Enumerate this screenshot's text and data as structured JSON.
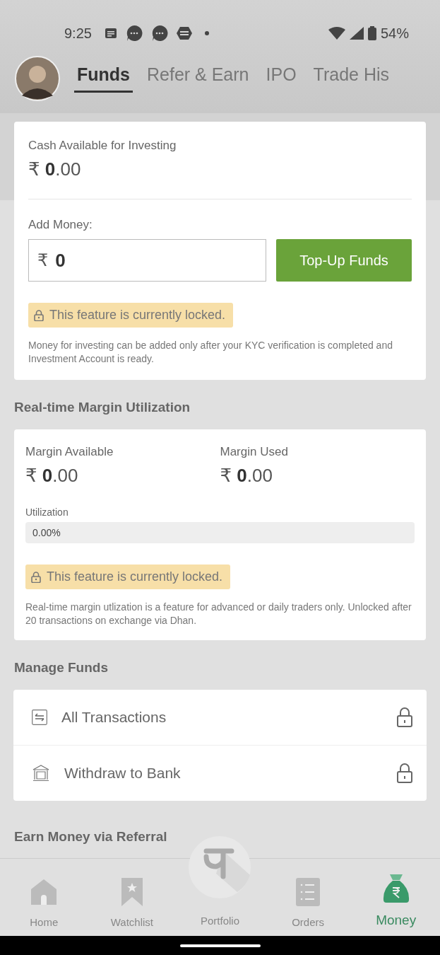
{
  "status_bar": {
    "time": "9:25",
    "battery": "54%"
  },
  "tabs": [
    {
      "label": "Funds",
      "selected": true
    },
    {
      "label": "Refer & Earn",
      "selected": false
    },
    {
      "label": "IPO",
      "selected": false
    },
    {
      "label": "Trade His",
      "selected": false
    }
  ],
  "cash_card": {
    "label": "Cash Available for Investing",
    "amount": "₹ **0**.00",
    "add_money": {
      "label": "Add Money:",
      "currency": "₹",
      "value": "0",
      "button": "Top-Up Funds"
    },
    "locked_notice": "This feature is currently locked.",
    "note": "Money for investing can be added only after your KYC verification is completed and Investment Account is ready."
  },
  "margin": {
    "heading": "Real-time Margin Utilization",
    "stats": [
      {
        "label": "Margin Available",
        "amount": "₹ **0**.00"
      },
      {
        "label": "Margin Used",
        "amount": "₹ **0**.00"
      }
    ],
    "utilization": {
      "label": "Utilization",
      "level": 0,
      "reading": "0.00%"
    },
    "locked_notice": "This feature is currently locked.",
    "note": "Real-time margin utlization is a feature for advanced or daily traders only. Unlocked after 20 transactions on exchange via Dhan."
  },
  "manage_funds": {
    "heading": "Manage Funds",
    "items": [
      {
        "kind": "transactions",
        "label": "All Transactions",
        "locked": true
      },
      {
        "kind": "bank",
        "label": "Withdraw to Bank",
        "locked": true
      }
    ]
  },
  "referral": {
    "heading": "Earn Money via Referral"
  },
  "bottom_nav": [
    {
      "kind": "home",
      "label": "Home",
      "selected": false
    },
    {
      "kind": "watchlist",
      "label": "Watchlist",
      "selected": false
    },
    {
      "kind": "portfolio",
      "label": "Portfolio",
      "selected": false
    },
    {
      "kind": "orders",
      "label": "Orders",
      "selected": false
    },
    {
      "kind": "money",
      "label": "Money",
      "selected": true
    }
  ]
}
